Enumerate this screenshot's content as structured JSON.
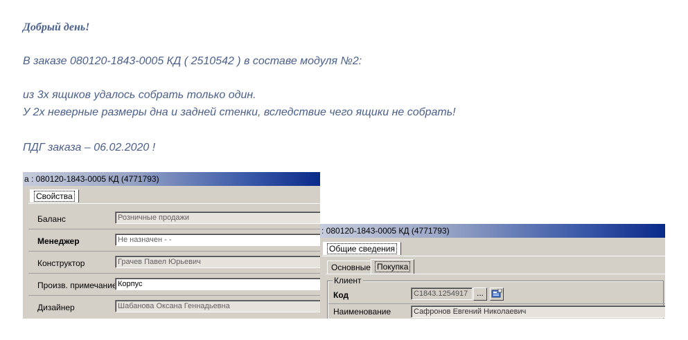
{
  "email": {
    "greeting": "Добрый день!",
    "line1": "В заказе 080120-1843-0005 КД ( 2510542 ) в составе модуля №2:",
    "line2": " из 3х ящиков удалось собрать только один.",
    "line3": "У 2х неверные размеры дна и задней стенки, вследствие чего ящики не собрать!",
    "line4": "ПДГ заказа – 06.02.2020 !"
  },
  "window1": {
    "title": "а : 080120-1843-0005 КД (4771793)",
    "tab": "Свойства",
    "rows": [
      {
        "label": "Баланс",
        "value": "Розничные продажи"
      },
      {
        "label": "Менеджер",
        "value": "Не назначен - -"
      },
      {
        "label": "Конструктор",
        "value": "Грачев Павел Юрьевич"
      },
      {
        "label": "Произв. примечание",
        "value": "Корпус"
      },
      {
        "label": "Дизайнер",
        "value": "Шабанова Оксана Геннадьевна"
      }
    ]
  },
  "window2": {
    "title": ": 080120-1843-0005 КД (4771793)",
    "tab_main": "Общие сведения",
    "subtabs": [
      "Основные",
      "Покупка"
    ],
    "group_title": "Клиент",
    "code_label": "Код",
    "code_value": "C1843.1254917",
    "browse_label": "...",
    "name_label": "Наименование",
    "name_value": "Сафронов Евгений Николаевич"
  }
}
